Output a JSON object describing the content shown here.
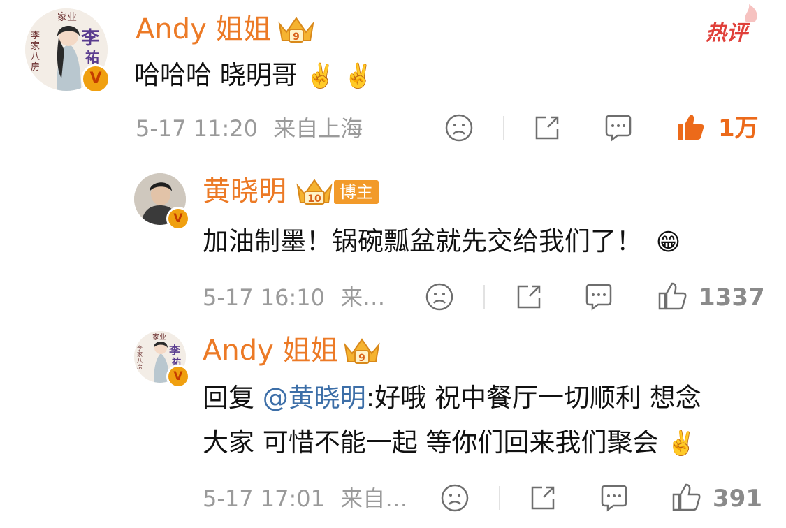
{
  "comments": [
    {
      "author": "Andy 姐姐",
      "hot_tag": "热评",
      "text": "哈哈哈 晓明哥",
      "time": "5-17 11:20",
      "location": "来自上海",
      "likes": "1万",
      "avatar_calligraphy": [
        "家业",
        "李",
        "祐",
        "李家八房"
      ]
    },
    {
      "author": "黄晓明",
      "badge_level": "10",
      "blogger_tag": "博主",
      "text": "加油制墨！锅碗瓢盆就先交给我们了！",
      "time": "5-17 16:10",
      "location": "来…",
      "likes": "1337"
    },
    {
      "author": "Andy 姐姐",
      "reply_prefix": "回复 ",
      "mention": "@黄晓明",
      "text_line1": ":好哦 祝中餐厅一切顺利 想念",
      "text_line2": "大家 可惜不能一起 等你们回来我们聚会",
      "time": "5-17 17:01",
      "location": "来自…",
      "likes": "391",
      "avatar_calligraphy": [
        "家业",
        "李",
        "祐",
        "李家八房"
      ]
    }
  ],
  "icons": [
    "dislike-face-icon",
    "share-icon",
    "comment-icon",
    "like-thumb-icon",
    "victory-hand-emoji",
    "grin-emoji",
    "crown-badge-icon",
    "verified-v-icon"
  ],
  "colors": {
    "name": "#ec7a26",
    "like_active": "#ec6a1a",
    "meta": "#9a9a9a",
    "mention": "#3d6fa8",
    "hot": "#e0403a"
  }
}
